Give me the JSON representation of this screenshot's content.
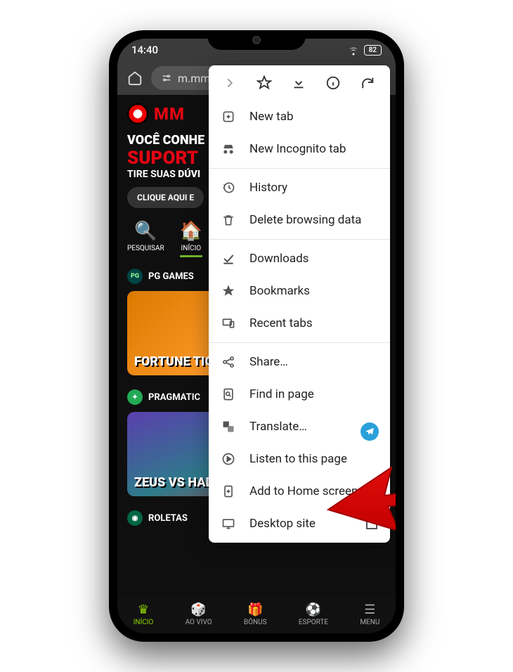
{
  "status": {
    "time": "14:40",
    "battery": "82"
  },
  "address": {
    "url_fragment": "m.mm"
  },
  "brand": {
    "name_visible": "MM"
  },
  "promo": {
    "line1": "VOCÊ CONHE",
    "line2": "SUPORT",
    "line3_a": "TIRE SUAS ",
    "line3_b": "DÚVI",
    "cta": "CLIQUE AQUI E"
  },
  "content_tabs": {
    "search": "PESQUISAR",
    "home": "INÍCIO"
  },
  "sections": {
    "pg": "PG GAMES",
    "pragmatic": "PRAGMATIC",
    "roletas": "ROLETAS"
  },
  "games": {
    "fortune_tiger": "FORTUNE TIGER",
    "zeus_hades": "ZEUS VS HADES"
  },
  "bottom_nav": {
    "inicio": "INÍCIO",
    "aovivo": "AO VIVO",
    "bonus": "BÔNUS",
    "esporte": "ESPORTE",
    "menu": "MENU"
  },
  "chrome_menu": {
    "new_tab": "New tab",
    "incognito": "New Incognito tab",
    "history": "History",
    "delete_data": "Delete browsing data",
    "downloads": "Downloads",
    "bookmarks": "Bookmarks",
    "recent_tabs": "Recent tabs",
    "share": "Share…",
    "find_in_page": "Find in page",
    "translate": "Translate…",
    "listen": "Listen to this page",
    "add_home": "Add to Home screen",
    "desktop_site": "Desktop site"
  }
}
